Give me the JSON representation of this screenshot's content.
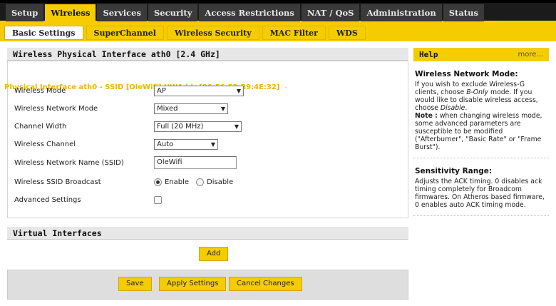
{
  "top_tabs": [
    {
      "label": "Setup",
      "active": false
    },
    {
      "label": "Wireless",
      "active": true
    },
    {
      "label": "Services",
      "active": false
    },
    {
      "label": "Security",
      "active": false
    },
    {
      "label": "Access Restrictions",
      "active": false
    },
    {
      "label": "NAT / QoS",
      "active": false
    },
    {
      "label": "Administration",
      "active": false
    },
    {
      "label": "Status",
      "active": false
    }
  ],
  "sub_tabs": [
    {
      "label": "Basic Settings",
      "active": true
    },
    {
      "label": "SuperChannel",
      "active": false
    },
    {
      "label": "Wireless Security",
      "active": false
    },
    {
      "label": "MAC Filter",
      "active": false
    },
    {
      "label": "WDS",
      "active": false
    }
  ],
  "physical": {
    "section_title": "Wireless Physical Interface ath0 [2.4 GHz]",
    "legend": "Physical Interface ath0 - SSID [OleWifi] HWAddr [90:F6:52:B9:4E:32]",
    "fields": {
      "wireless_mode": {
        "label": "Wireless Mode",
        "value": "AP"
      },
      "network_mode": {
        "label": "Wireless Network Mode",
        "value": "Mixed"
      },
      "channel_width": {
        "label": "Channel Width",
        "value": "Full (20 MHz)"
      },
      "channel": {
        "label": "Wireless Channel",
        "value": "Auto"
      },
      "ssid": {
        "label": "Wireless Network Name (SSID)",
        "value": "OleWifi"
      },
      "ssid_broadcast": {
        "label": "Wireless SSID Broadcast",
        "enable_label": "Enable",
        "disable_label": "Disable",
        "selected": "Enable"
      },
      "advanced": {
        "label": "Advanced Settings",
        "checked": false
      }
    }
  },
  "virtual": {
    "section_title": "Virtual Interfaces",
    "add_label": "Add"
  },
  "footer": {
    "save_label": "Save",
    "apply_label": "Apply Settings",
    "cancel_label": "Cancel Changes"
  },
  "help": {
    "title": "Help",
    "more": "more...",
    "sections": [
      {
        "heading": "Wireless Network Mode:",
        "p1_a": "If you wish to exclude Wireless-G clients, choose ",
        "p1_em1": "B-Only",
        "p1_b": " mode. If you would like to disable wireless access, choose ",
        "p1_em2": "Disable",
        "p1_c": ".",
        "note_label": "Note :",
        "note_text": " when changing wireless mode, some advanced parameters are susceptible to be modified (\"Afterburner\", \"Basic Rate\" or \"Frame Burst\")."
      },
      {
        "heading": "Sensitivity Range:",
        "text": "Adjusts the ACK timing. 0 disables ack timing completely for Broadcom firmwares. On Atheros based firmware, 0 enables auto ACK timing mode."
      }
    ]
  },
  "colors": {
    "accent": "#f4cc00",
    "legend": "#f0b400",
    "topbar": "#1b1b1b"
  }
}
